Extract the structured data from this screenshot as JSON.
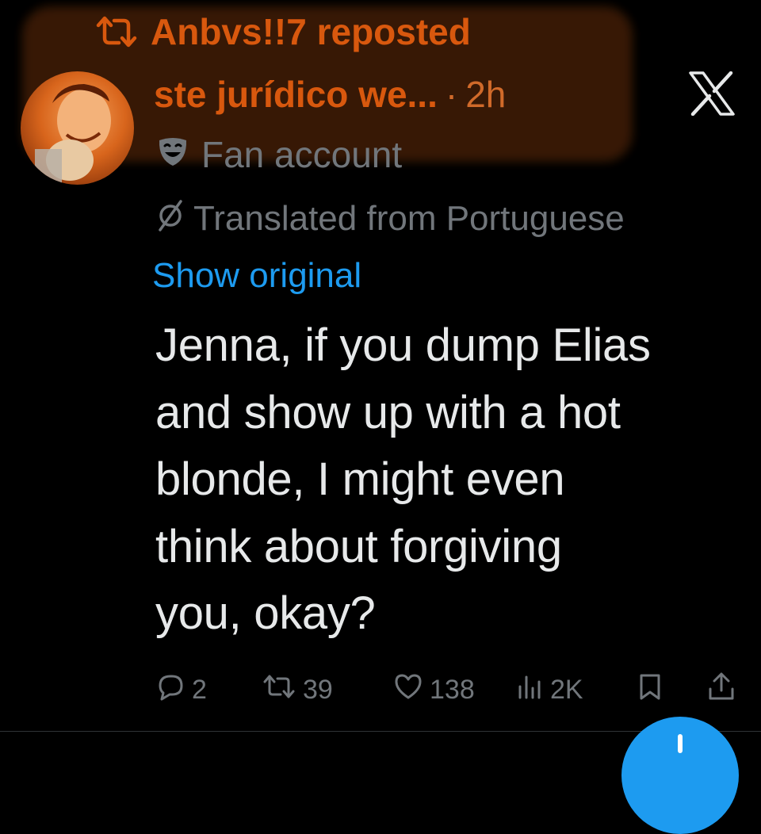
{
  "repost": {
    "text": "Anbvs!!7 reposted",
    "icon": "repost-icon",
    "color": "#d8580e"
  },
  "author": {
    "display_name": "ste jurídico we...",
    "separator": "·",
    "time": "2h",
    "label": "Fan account",
    "label_icon": "theater-masks-icon"
  },
  "translation": {
    "notice": "Translated from Portuguese",
    "notice_icon": "null-set-icon",
    "show_original": "Show original",
    "link_color": "#1d9bf0"
  },
  "tweet": {
    "lines": [
      "Jenna, if you dump Elias",
      "and show up with a hot",
      "blonde, I might even",
      "think about forgiving",
      "you, okay?"
    ]
  },
  "actions": {
    "replies": "2",
    "reposts": "39",
    "likes": "138",
    "views": "2K"
  },
  "platform_logo": "x-logo-icon",
  "fab_icon": "plus-icon"
}
